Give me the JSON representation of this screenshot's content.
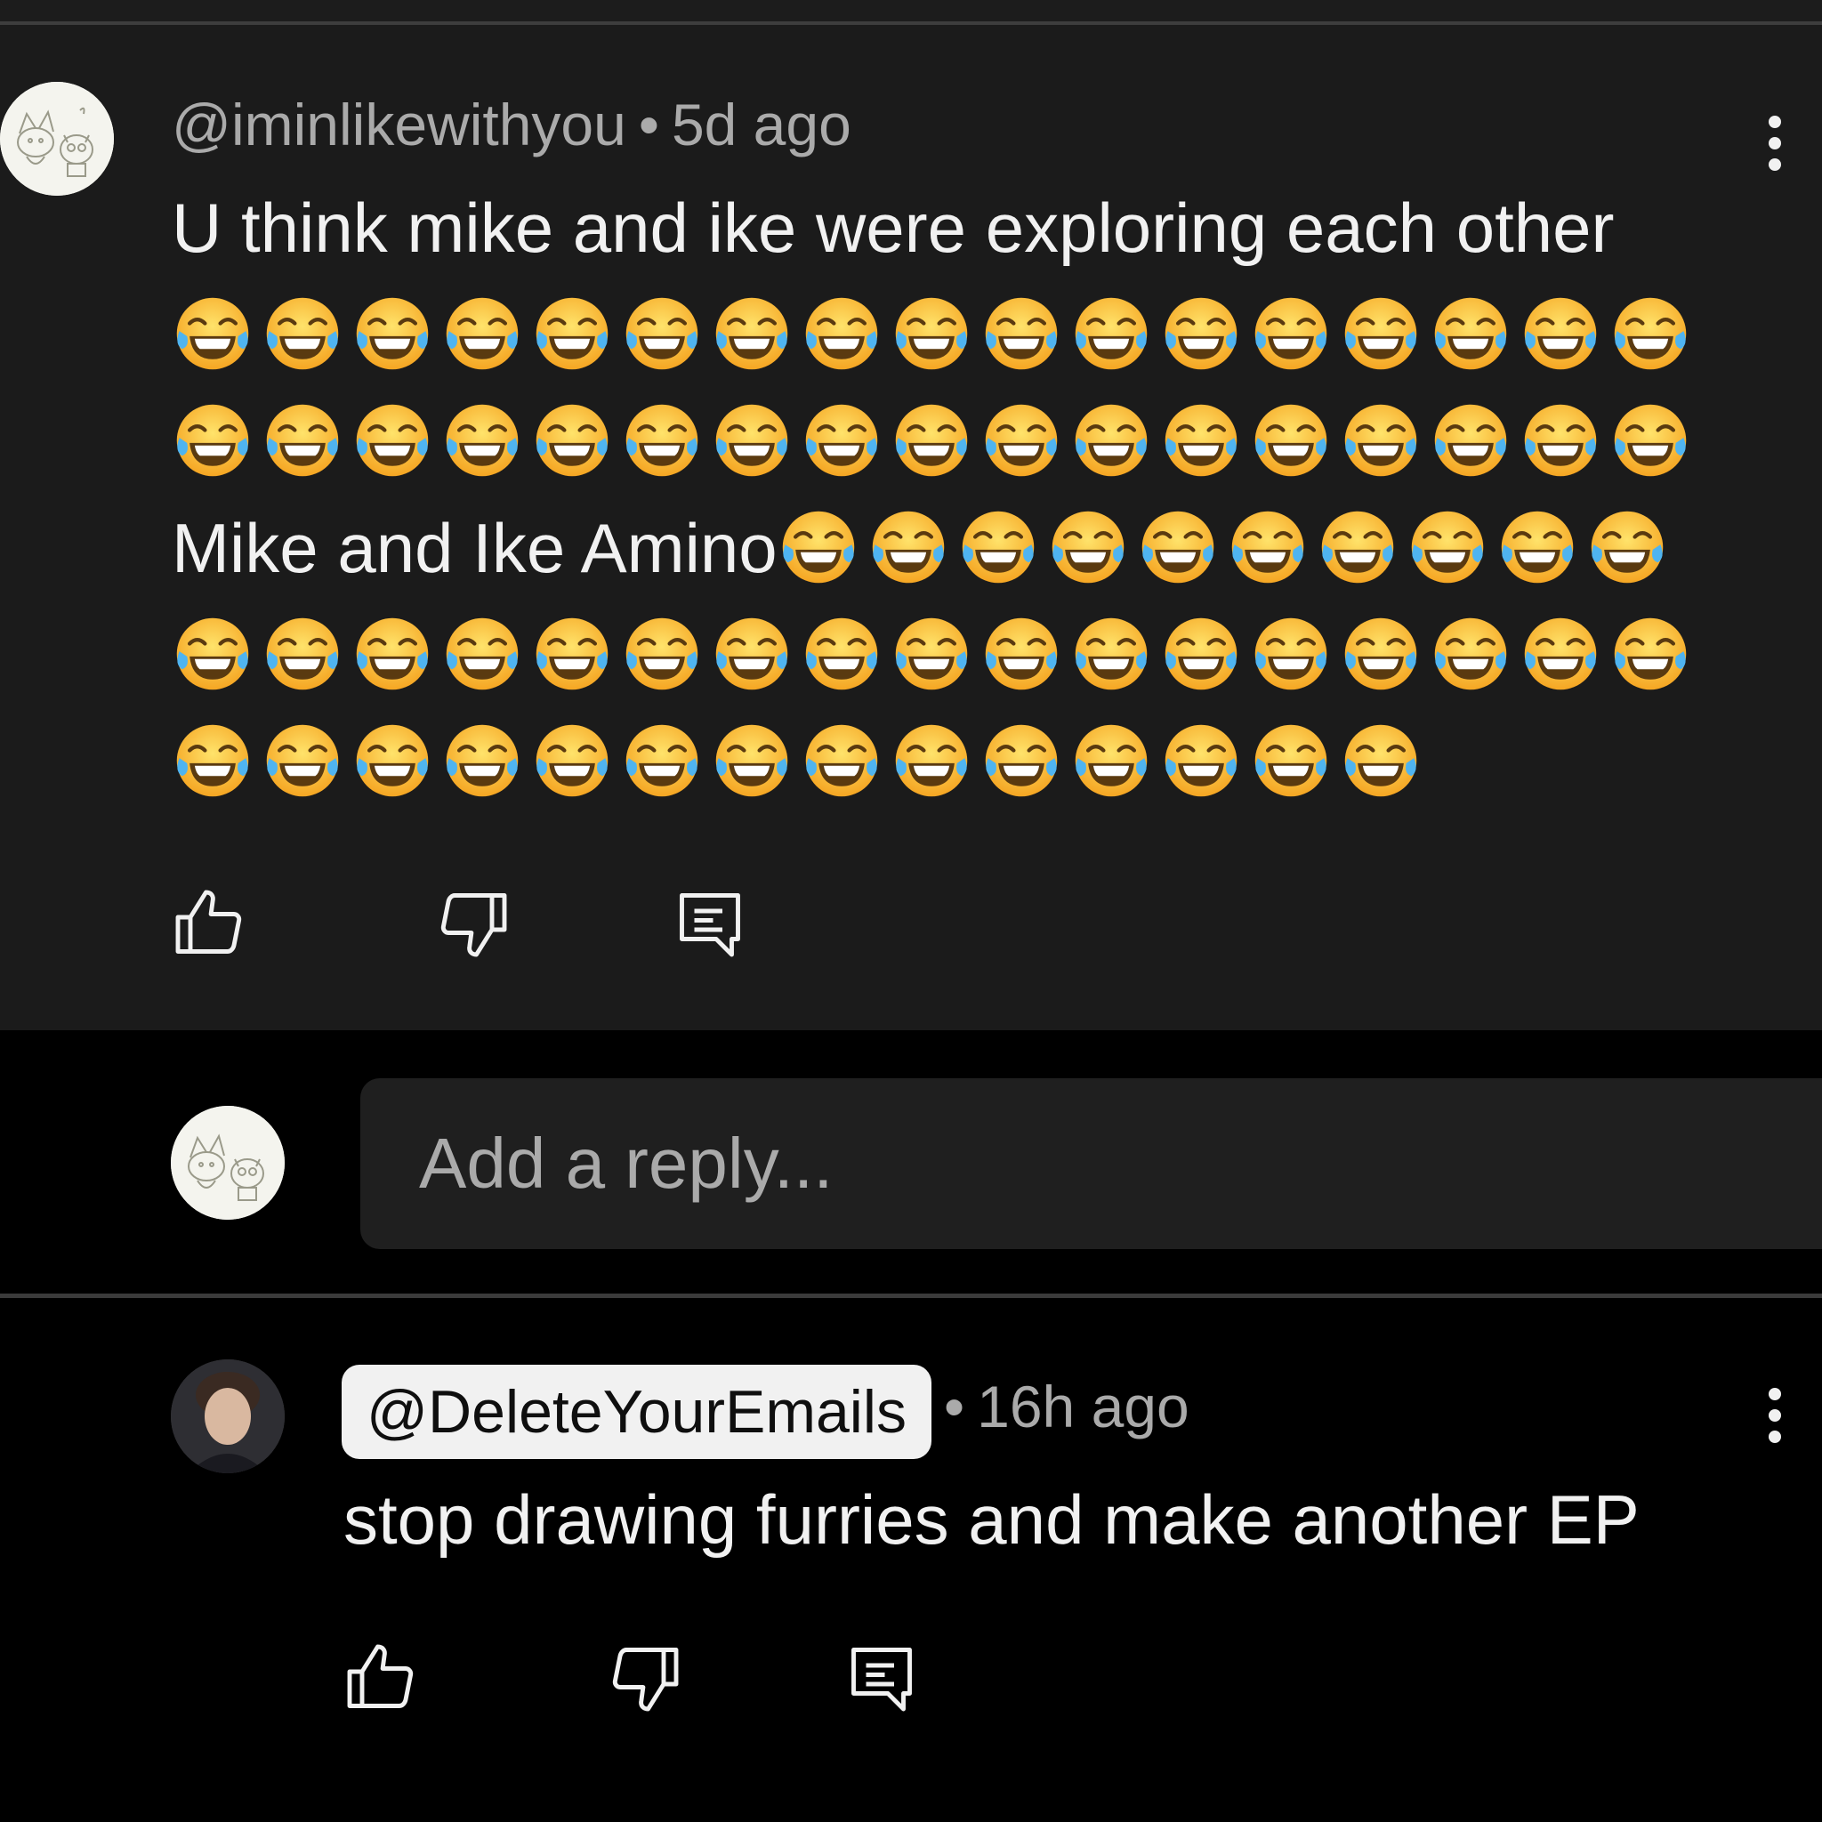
{
  "comment1": {
    "handle": "@iminlikewithyou",
    "separator": "•",
    "time": "5d ago",
    "line1": "U think mike and ike were exploring each other",
    "line3_text": "Mike and Ike Amino",
    "emoji_name": "face-with-tears-of-joy",
    "emoji_rows": [
      17,
      17,
      10,
      17,
      14
    ]
  },
  "reply": {
    "placeholder": "Add a reply..."
  },
  "comment2": {
    "handle": "@DeleteYourEmails",
    "separator": "•",
    "time": "16h ago",
    "text": "stop drawing furries and make another EP"
  },
  "icons": {
    "like": "thumbs-up-icon",
    "dislike": "thumbs-down-icon",
    "reply": "reply-comment-icon",
    "more": "more-vertical-icon"
  },
  "colors": {
    "background": "#000000",
    "card": "#1b1b1b",
    "text": "#f1f1f1",
    "muted": "#aaaaaa"
  }
}
